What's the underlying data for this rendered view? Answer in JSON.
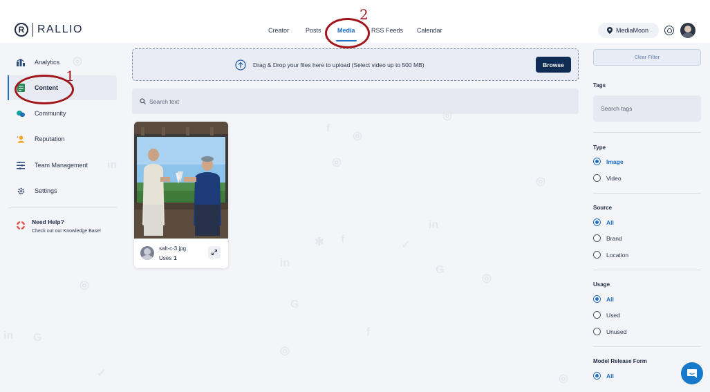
{
  "app": {
    "logo_text": "RALLIO",
    "logo_mark": "R"
  },
  "nav": {
    "items": [
      {
        "label": "Creator"
      },
      {
        "label": "Posts"
      },
      {
        "label": "Media"
      },
      {
        "label": "RSS Feeds"
      },
      {
        "label": "Calendar"
      }
    ],
    "active": "Media"
  },
  "header": {
    "location_name": "MediaMoon"
  },
  "sidebar": {
    "items": [
      {
        "label": "Analytics",
        "icon": "analytics-icon"
      },
      {
        "label": "Content",
        "icon": "content-icon",
        "active": true
      },
      {
        "label": "Community",
        "icon": "community-icon"
      },
      {
        "label": "Reputation",
        "icon": "reputation-icon"
      },
      {
        "label": "Team Management",
        "icon": "team-management-icon"
      },
      {
        "label": "Settings",
        "icon": "gear-icon"
      }
    ],
    "help": {
      "title": "Need Help?",
      "subtitle": "Check out our Knowledge Base!"
    }
  },
  "upload": {
    "text": "Drag & Drop your files here to upload (Select video up to 500 MB)",
    "browse_label": "Browse"
  },
  "search": {
    "placeholder": "Search text"
  },
  "media": [
    {
      "filename": "salt-c-3.jpg",
      "uses_label": "Uses",
      "uses_count": "1"
    }
  ],
  "filters": {
    "clear_label": "Clear Filter",
    "tags": {
      "label": "Tags",
      "placeholder": "Search tags"
    },
    "type": {
      "label": "Type",
      "options": [
        "Image",
        "Video"
      ],
      "selected": "Image"
    },
    "source": {
      "label": "Source",
      "options": [
        "All",
        "Brand",
        "Location"
      ],
      "selected": "All"
    },
    "usage": {
      "label": "Usage",
      "options": [
        "All",
        "Used",
        "Unused"
      ],
      "selected": "All"
    },
    "model_release": {
      "label": "Model Release Form",
      "options": [
        "All"
      ],
      "selected": "All"
    }
  },
  "annotations": {
    "one": "1",
    "two": "2"
  },
  "colors": {
    "accent": "#1e6fc6",
    "primary_button": "#0f2c55",
    "annotation": "#a0151b"
  }
}
